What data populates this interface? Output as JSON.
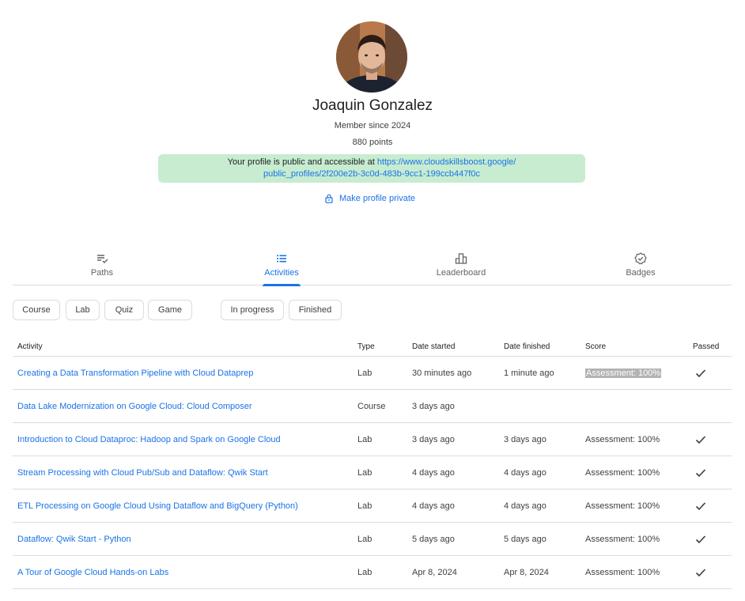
{
  "profile": {
    "name": "Joaquin Gonzalez",
    "member_since": "Member since 2024",
    "points": "880 points",
    "public_notice_prefix": "Your profile is public and accessible at ",
    "public_url_line1": "https://www.cloudskillsboost.google/",
    "public_url_line2": "public_profiles/2f200e2b-3c0d-483b-9cc1-199ccb447f0c",
    "make_private_label": "Make profile private"
  },
  "tabs": [
    {
      "label": "Paths",
      "icon": "checklist-icon"
    },
    {
      "label": "Activities",
      "icon": "list-icon",
      "active": true
    },
    {
      "label": "Leaderboard",
      "icon": "leaderboard-icon"
    },
    {
      "label": "Badges",
      "icon": "verified-badge-icon"
    }
  ],
  "filters": {
    "type": [
      "Course",
      "Lab",
      "Quiz",
      "Game"
    ],
    "status": [
      "In progress",
      "Finished"
    ]
  },
  "table": {
    "headers": {
      "activity": "Activity",
      "type": "Type",
      "date_started": "Date started",
      "date_finished": "Date finished",
      "score": "Score",
      "passed": "Passed"
    },
    "rows": [
      {
        "activity": "Creating a Data Transformation Pipeline with Cloud Dataprep",
        "type": "Lab",
        "started": "30 minutes ago",
        "finished": "1 minute ago",
        "score": "Assessment: 100%",
        "passed": true
      },
      {
        "activity": "Data Lake Modernization on Google Cloud: Cloud Composer",
        "type": "Course",
        "started": "3 days ago",
        "finished": "",
        "score": "",
        "passed": false
      },
      {
        "activity": "Introduction to Cloud Dataproc: Hadoop and Spark on Google Cloud",
        "type": "Lab",
        "started": "3 days ago",
        "finished": "3 days ago",
        "score": "Assessment: 100%",
        "passed": true
      },
      {
        "activity": "Stream Processing with Cloud Pub/Sub and Dataflow: Qwik Start",
        "type": "Lab",
        "started": "4 days ago",
        "finished": "4 days ago",
        "score": "Assessment: 100%",
        "passed": true
      },
      {
        "activity": "ETL Processing on Google Cloud Using Dataflow and BigQuery (Python)",
        "type": "Lab",
        "started": "4 days ago",
        "finished": "4 days ago",
        "score": "Assessment: 100%",
        "passed": true
      },
      {
        "activity": "Dataflow: Qwik Start - Python",
        "type": "Lab",
        "started": "5 days ago",
        "finished": "5 days ago",
        "score": "Assessment: 100%",
        "passed": true
      },
      {
        "activity": "A Tour of Google Cloud Hands-on Labs",
        "type": "Lab",
        "started": "Apr 8, 2024",
        "finished": "Apr 8, 2024",
        "score": "Assessment: 100%",
        "passed": true
      }
    ]
  },
  "colors": {
    "link": "#1a73e8",
    "banner_bg": "#c7ecd0",
    "divider": "#dadce0"
  }
}
